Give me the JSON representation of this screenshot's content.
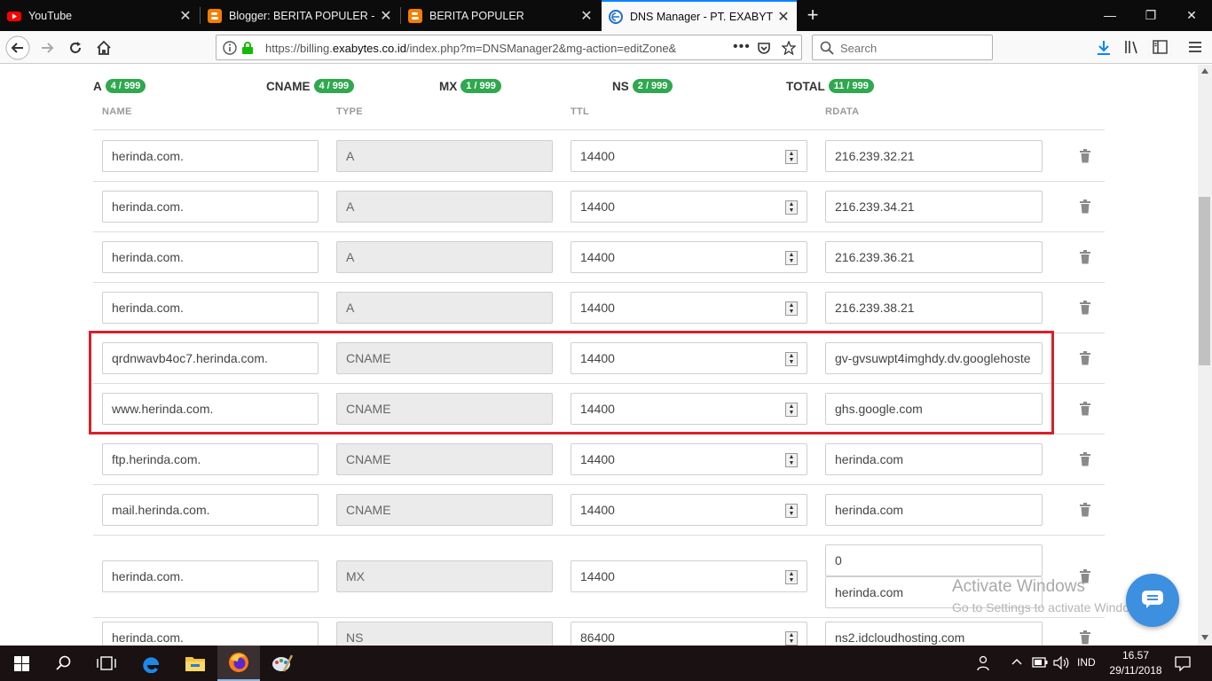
{
  "browser": {
    "tabs": [
      {
        "label": "YouTube",
        "icon": "youtube-icon"
      },
      {
        "label": "Blogger: BERITA POPULER - Set",
        "icon": "blogger-icon"
      },
      {
        "label": "BERITA POPULER",
        "icon": "blogger-icon"
      },
      {
        "label": "DNS Manager - PT. EXABYTES I",
        "icon": "exabytes-icon",
        "active": true
      }
    ],
    "url_prefix": "https://billing.",
    "url_domain": "exabytes.co.id",
    "url_rest": "/index.php?m=DNSManager2&mg-action=editZone&",
    "search_placeholder": "Search",
    "accent": "#0a84ff"
  },
  "summary": {
    "a": {
      "label": "A",
      "badge": "4 / 999"
    },
    "cname": {
      "label": "CNAME",
      "badge": "4 / 999"
    },
    "mx": {
      "label": "MX",
      "badge": "1 / 999"
    },
    "ns": {
      "label": "NS",
      "badge": "2 / 999"
    },
    "total": {
      "label": "TOTAL",
      "badge": "11 / 999"
    },
    "badge_color": "#2fa84f"
  },
  "columns": {
    "name": "NAME",
    "type": "TYPE",
    "ttl": "TTL",
    "rdata": "RDATA"
  },
  "records": [
    {
      "name": "herinda.com.",
      "type": "A",
      "ttl": "14400",
      "rdata": [
        "216.239.32.21"
      ]
    },
    {
      "name": "herinda.com.",
      "type": "A",
      "ttl": "14400",
      "rdata": [
        "216.239.34.21"
      ]
    },
    {
      "name": "herinda.com.",
      "type": "A",
      "ttl": "14400",
      "rdata": [
        "216.239.36.21"
      ]
    },
    {
      "name": "herinda.com.",
      "type": "A",
      "ttl": "14400",
      "rdata": [
        "216.239.38.21"
      ]
    },
    {
      "name": "qrdnwavb4oc7.herinda.com.",
      "type": "CNAME",
      "ttl": "14400",
      "rdata": [
        "gv-gvsuwpt4imghdy.dv.googlehoste"
      ]
    },
    {
      "name": "www.herinda.com.",
      "type": "CNAME",
      "ttl": "14400",
      "rdata": [
        "ghs.google.com"
      ]
    },
    {
      "name": "ftp.herinda.com.",
      "type": "CNAME",
      "ttl": "14400",
      "rdata": [
        "herinda.com"
      ]
    },
    {
      "name": "mail.herinda.com.",
      "type": "CNAME",
      "ttl": "14400",
      "rdata": [
        "herinda.com"
      ]
    },
    {
      "name": "herinda.com.",
      "type": "MX",
      "ttl": "14400",
      "rdata": [
        "0",
        "herinda.com"
      ]
    },
    {
      "name": "herinda.com.",
      "type": "NS",
      "ttl": "86400",
      "rdata": [
        "ns2.idcloudhosting.com"
      ]
    }
  ],
  "highlight_color": "#d9202a",
  "watermark": {
    "line1": "Activate Windows",
    "line2": "Go to Settings to activate Windows."
  },
  "taskbar": {
    "lang": "IND",
    "time": "16.57",
    "date": "29/11/2018"
  }
}
